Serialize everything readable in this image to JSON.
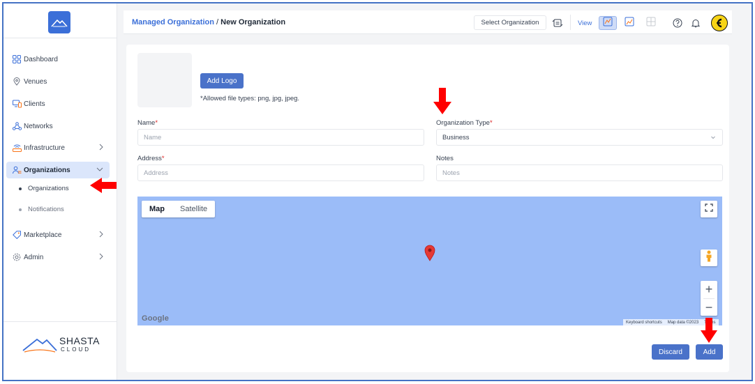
{
  "sidebar": {
    "items": [
      {
        "label": "Dashboard",
        "icon": "dashboard-grid-icon"
      },
      {
        "label": "Venues",
        "icon": "location-pin-icon"
      },
      {
        "label": "Clients",
        "icon": "devices-icon"
      },
      {
        "label": "Networks",
        "icon": "network-icon"
      },
      {
        "label": "Infrastructure",
        "icon": "router-icon"
      },
      {
        "label": "Organizations",
        "icon": "users-icon",
        "active": true
      },
      {
        "label": "Marketplace",
        "icon": "tag-icon"
      },
      {
        "label": "Admin",
        "icon": "gear-icon"
      }
    ],
    "subitems": [
      {
        "label": "Organizations",
        "active": true
      },
      {
        "label": "Notifications",
        "active": false
      }
    ],
    "brand_name": "SHASTA",
    "brand_sub": "CLOUD"
  },
  "header": {
    "breadcrumb_link": "Managed Organization",
    "breadcrumb_sep": "/",
    "breadcrumb_current": "New Organization",
    "select_org": "Select Organization",
    "view_label": "View"
  },
  "form": {
    "add_logo": "Add Logo",
    "allowed_types": "*Allowed file types: png, jpg, jpeg.",
    "name_label": "Name",
    "name_placeholder": "Name",
    "org_type_label": "Organization Type",
    "org_type_value": "Business",
    "address_label": "Address",
    "address_placeholder": "Address",
    "notes_label": "Notes",
    "notes_placeholder": "Notes",
    "required_mark": "*"
  },
  "map": {
    "tab_map": "Map",
    "tab_satellite": "Satellite",
    "google": "Google",
    "keyboard_shortcuts": "Keyboard shortcuts",
    "map_data": "Map data ©2023",
    "terms": "Terms",
    "zoom_in": "+",
    "zoom_out": "−"
  },
  "actions": {
    "discard": "Discard",
    "add": "Add"
  },
  "colors": {
    "accent": "#3b6fd8",
    "button": "#4a72c9",
    "map_water": "#9bbcf8",
    "annotation_arrow": "#ff0000"
  }
}
